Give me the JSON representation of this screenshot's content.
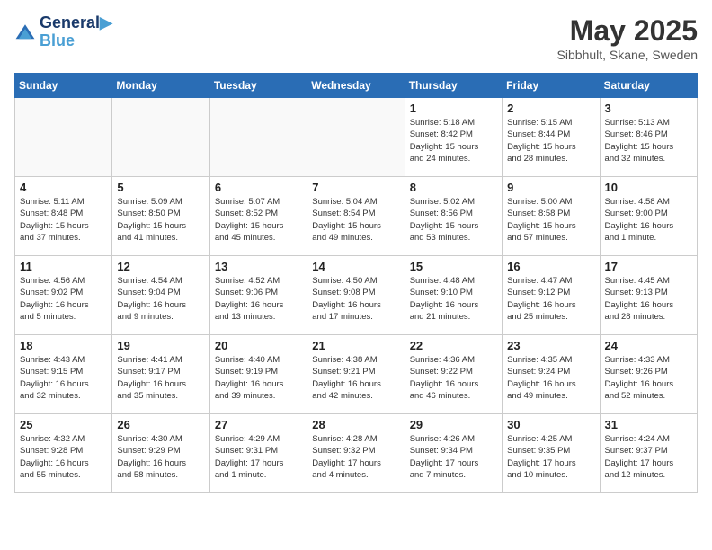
{
  "header": {
    "logo_line1": "General",
    "logo_line2": "Blue",
    "month": "May 2025",
    "location": "Sibbhult, Skane, Sweden"
  },
  "weekdays": [
    "Sunday",
    "Monday",
    "Tuesday",
    "Wednesday",
    "Thursday",
    "Friday",
    "Saturday"
  ],
  "weeks": [
    [
      {
        "day": "",
        "info": ""
      },
      {
        "day": "",
        "info": ""
      },
      {
        "day": "",
        "info": ""
      },
      {
        "day": "",
        "info": ""
      },
      {
        "day": "1",
        "info": "Sunrise: 5:18 AM\nSunset: 8:42 PM\nDaylight: 15 hours\nand 24 minutes."
      },
      {
        "day": "2",
        "info": "Sunrise: 5:15 AM\nSunset: 8:44 PM\nDaylight: 15 hours\nand 28 minutes."
      },
      {
        "day": "3",
        "info": "Sunrise: 5:13 AM\nSunset: 8:46 PM\nDaylight: 15 hours\nand 32 minutes."
      }
    ],
    [
      {
        "day": "4",
        "info": "Sunrise: 5:11 AM\nSunset: 8:48 PM\nDaylight: 15 hours\nand 37 minutes."
      },
      {
        "day": "5",
        "info": "Sunrise: 5:09 AM\nSunset: 8:50 PM\nDaylight: 15 hours\nand 41 minutes."
      },
      {
        "day": "6",
        "info": "Sunrise: 5:07 AM\nSunset: 8:52 PM\nDaylight: 15 hours\nand 45 minutes."
      },
      {
        "day": "7",
        "info": "Sunrise: 5:04 AM\nSunset: 8:54 PM\nDaylight: 15 hours\nand 49 minutes."
      },
      {
        "day": "8",
        "info": "Sunrise: 5:02 AM\nSunset: 8:56 PM\nDaylight: 15 hours\nand 53 minutes."
      },
      {
        "day": "9",
        "info": "Sunrise: 5:00 AM\nSunset: 8:58 PM\nDaylight: 15 hours\nand 57 minutes."
      },
      {
        "day": "10",
        "info": "Sunrise: 4:58 AM\nSunset: 9:00 PM\nDaylight: 16 hours\nand 1 minute."
      }
    ],
    [
      {
        "day": "11",
        "info": "Sunrise: 4:56 AM\nSunset: 9:02 PM\nDaylight: 16 hours\nand 5 minutes."
      },
      {
        "day": "12",
        "info": "Sunrise: 4:54 AM\nSunset: 9:04 PM\nDaylight: 16 hours\nand 9 minutes."
      },
      {
        "day": "13",
        "info": "Sunrise: 4:52 AM\nSunset: 9:06 PM\nDaylight: 16 hours\nand 13 minutes."
      },
      {
        "day": "14",
        "info": "Sunrise: 4:50 AM\nSunset: 9:08 PM\nDaylight: 16 hours\nand 17 minutes."
      },
      {
        "day": "15",
        "info": "Sunrise: 4:48 AM\nSunset: 9:10 PM\nDaylight: 16 hours\nand 21 minutes."
      },
      {
        "day": "16",
        "info": "Sunrise: 4:47 AM\nSunset: 9:12 PM\nDaylight: 16 hours\nand 25 minutes."
      },
      {
        "day": "17",
        "info": "Sunrise: 4:45 AM\nSunset: 9:13 PM\nDaylight: 16 hours\nand 28 minutes."
      }
    ],
    [
      {
        "day": "18",
        "info": "Sunrise: 4:43 AM\nSunset: 9:15 PM\nDaylight: 16 hours\nand 32 minutes."
      },
      {
        "day": "19",
        "info": "Sunrise: 4:41 AM\nSunset: 9:17 PM\nDaylight: 16 hours\nand 35 minutes."
      },
      {
        "day": "20",
        "info": "Sunrise: 4:40 AM\nSunset: 9:19 PM\nDaylight: 16 hours\nand 39 minutes."
      },
      {
        "day": "21",
        "info": "Sunrise: 4:38 AM\nSunset: 9:21 PM\nDaylight: 16 hours\nand 42 minutes."
      },
      {
        "day": "22",
        "info": "Sunrise: 4:36 AM\nSunset: 9:22 PM\nDaylight: 16 hours\nand 46 minutes."
      },
      {
        "day": "23",
        "info": "Sunrise: 4:35 AM\nSunset: 9:24 PM\nDaylight: 16 hours\nand 49 minutes."
      },
      {
        "day": "24",
        "info": "Sunrise: 4:33 AM\nSunset: 9:26 PM\nDaylight: 16 hours\nand 52 minutes."
      }
    ],
    [
      {
        "day": "25",
        "info": "Sunrise: 4:32 AM\nSunset: 9:28 PM\nDaylight: 16 hours\nand 55 minutes."
      },
      {
        "day": "26",
        "info": "Sunrise: 4:30 AM\nSunset: 9:29 PM\nDaylight: 16 hours\nand 58 minutes."
      },
      {
        "day": "27",
        "info": "Sunrise: 4:29 AM\nSunset: 9:31 PM\nDaylight: 17 hours\nand 1 minute."
      },
      {
        "day": "28",
        "info": "Sunrise: 4:28 AM\nSunset: 9:32 PM\nDaylight: 17 hours\nand 4 minutes."
      },
      {
        "day": "29",
        "info": "Sunrise: 4:26 AM\nSunset: 9:34 PM\nDaylight: 17 hours\nand 7 minutes."
      },
      {
        "day": "30",
        "info": "Sunrise: 4:25 AM\nSunset: 9:35 PM\nDaylight: 17 hours\nand 10 minutes."
      },
      {
        "day": "31",
        "info": "Sunrise: 4:24 AM\nSunset: 9:37 PM\nDaylight: 17 hours\nand 12 minutes."
      }
    ]
  ]
}
